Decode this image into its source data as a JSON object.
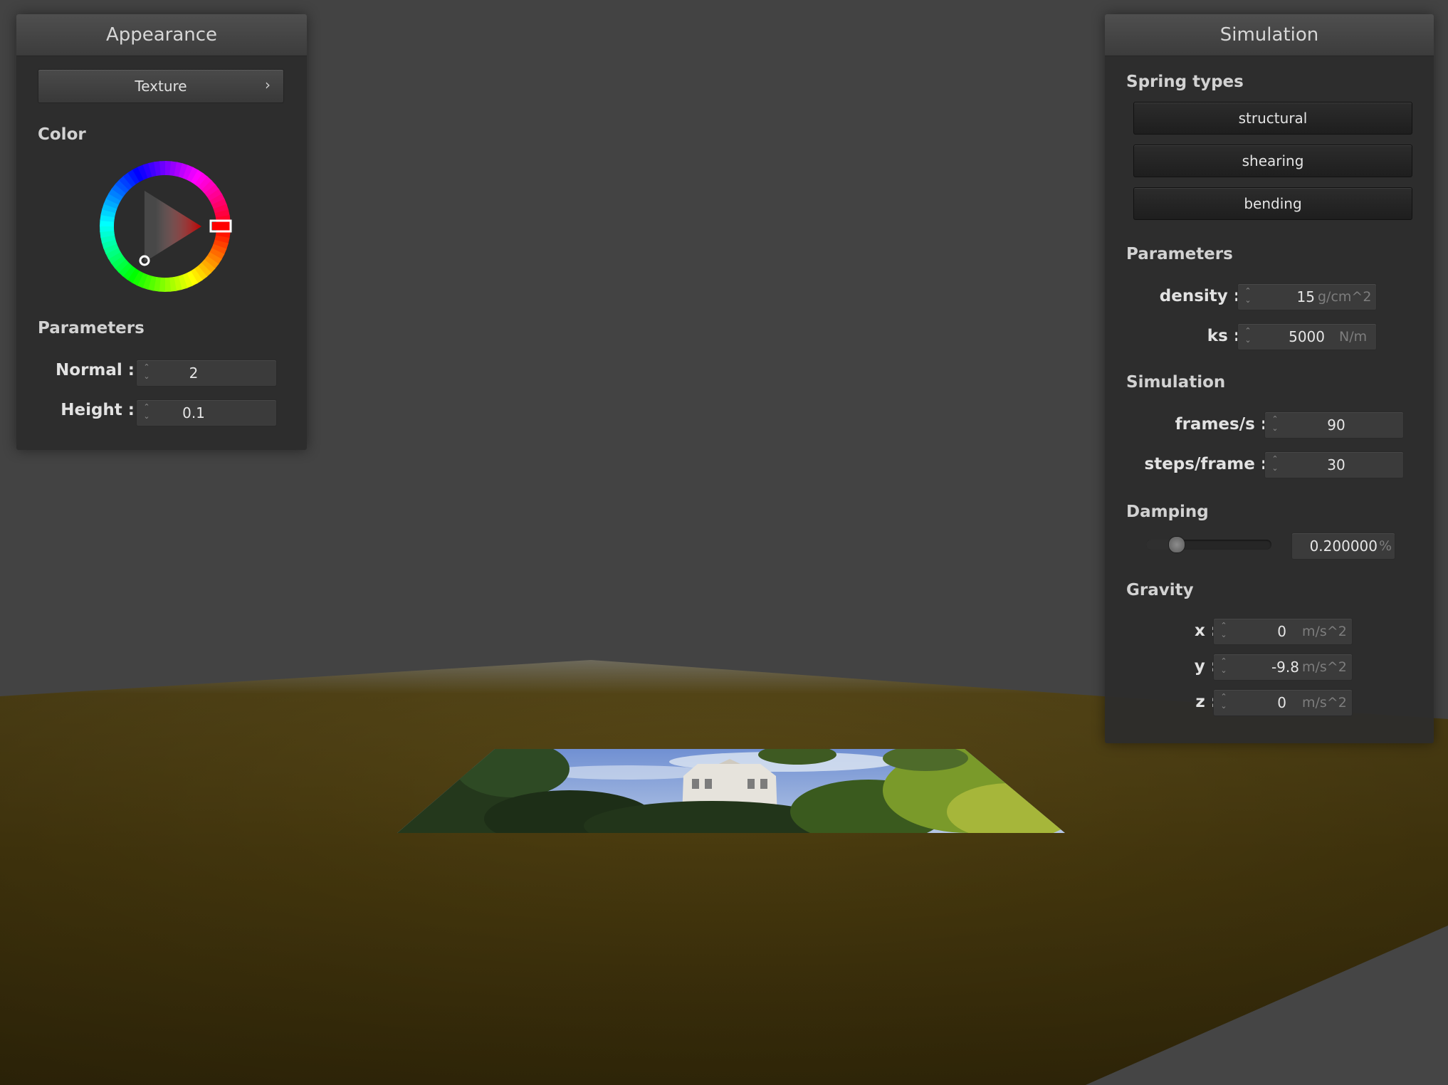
{
  "appearance": {
    "title": "Appearance",
    "texture_button": "Texture",
    "texture_chevron": "›",
    "color_label": "Color",
    "color_value": "#ff0000",
    "parameters_label": "Parameters",
    "normal_label": "Normal :",
    "normal_value": "2",
    "height_label": "Height :",
    "height_value": "0.1"
  },
  "simulation": {
    "title": "Simulation",
    "spring_types_label": "Spring types",
    "spring_types": [
      "structural",
      "shearing",
      "bending"
    ],
    "parameters_label": "Parameters",
    "density_label": "density :",
    "density_value": "15",
    "density_unit": "g/cm^2",
    "ks_label": "ks :",
    "ks_value": "5000",
    "ks_unit": "N/m",
    "simulation_label": "Simulation",
    "fps_label": "frames/s :",
    "fps_value": "90",
    "steps_label": "steps/frame :",
    "steps_value": "30",
    "damping_label": "Damping",
    "damping_value": "0.200000",
    "damping_unit": "%",
    "damping_fraction": 0.2,
    "gravity_label": "Gravity",
    "gravity_x_label": "x :",
    "gravity_x_value": "0",
    "gravity_y_label": "y :",
    "gravity_y_value": "-9.8",
    "gravity_z_label": "z :",
    "gravity_z_value": "0",
    "gravity_unit": "m/s^2"
  },
  "spinner": {
    "up": "⌃",
    "down": "⌄"
  },
  "colors": {
    "background": "#434343",
    "floor": "#4a3c0f",
    "accent": "#ff0000"
  }
}
